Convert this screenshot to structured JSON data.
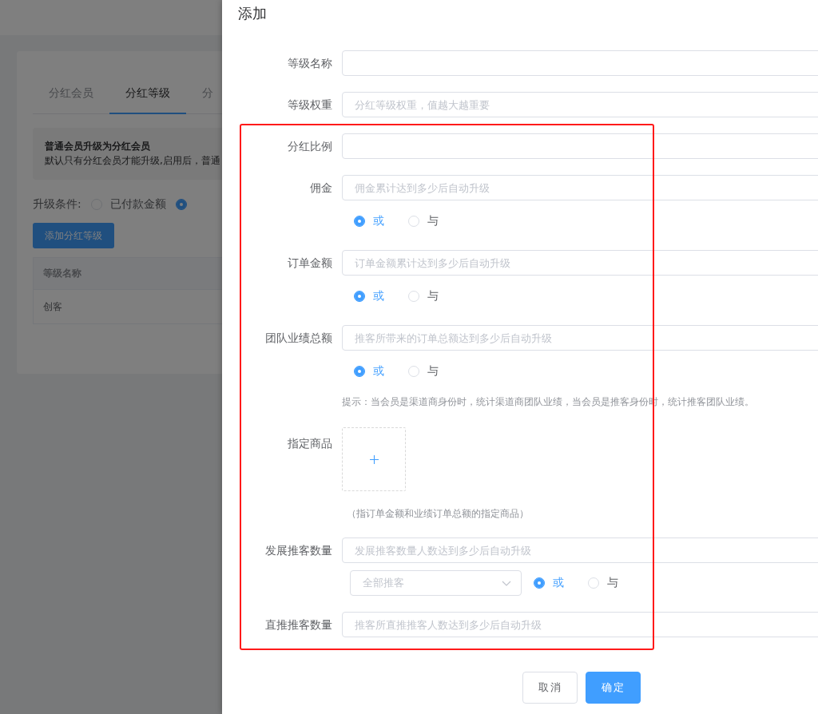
{
  "background": {
    "tabs": [
      {
        "label": "分红会员",
        "selected": false
      },
      {
        "label": "分红等级",
        "selected": true
      },
      {
        "label": "分",
        "selected": false
      }
    ],
    "notice": {
      "title": "普通会员升级为分红会员",
      "text": "默认只有分红会员才能升级,启用后，普通"
    },
    "upgrade_condition": {
      "label": "升级条件:",
      "options": [
        {
          "label": "已付款金额",
          "selected": false
        },
        {
          "selected": true
        }
      ]
    },
    "add_button": "添加分红等级",
    "table": {
      "columns": [
        "等级名称"
      ],
      "rows": [
        [
          "创客"
        ]
      ]
    }
  },
  "dialog": {
    "title": "添加",
    "rows": [
      {
        "kind": "input",
        "label": "等级名称"
      },
      {
        "kind": "input",
        "label": "等级权重",
        "placeholder": "分红等级权重，值越大越重要"
      },
      {
        "kind": "input",
        "label": "分红比例"
      },
      {
        "kind": "input",
        "label": "佣金",
        "placeholder": "佣金累计达到多少后自动升级"
      },
      {
        "kind": "logic",
        "options": [
          {
            "label": "或",
            "selected": true
          },
          {
            "label": "与",
            "selected": false
          }
        ]
      },
      {
        "kind": "input",
        "label": "订单金额",
        "placeholder": "订单金额累计达到多少后自动升级"
      },
      {
        "kind": "logic",
        "options": [
          {
            "label": "或",
            "selected": true
          },
          {
            "label": "与",
            "selected": false
          }
        ]
      },
      {
        "kind": "input",
        "label": "团队业绩总额",
        "placeholder": "推客所带来的订单总额达到多少后自动升级"
      },
      {
        "kind": "logic",
        "options": [
          {
            "label": "或",
            "selected": true
          },
          {
            "label": "与",
            "selected": false
          }
        ]
      },
      {
        "kind": "hint",
        "text": "提示：当会员是渠道商身份时，统计渠道商团队业绩，当会员是推客身份时，统计推客团队业绩。"
      },
      {
        "kind": "upload",
        "label": "指定商品"
      },
      {
        "kind": "note",
        "text": "（指订单金额和业绩订单总额的指定商品）"
      },
      {
        "kind": "input",
        "label": "发展推客数量",
        "placeholder": "发展推客数量人数达到多少后自动升级"
      },
      {
        "kind": "select_logic",
        "select_placeholder": "全部推客",
        "options": [
          {
            "label": "或",
            "selected": true
          },
          {
            "label": "与",
            "selected": false
          }
        ]
      },
      {
        "kind": "input",
        "label": "直推推客数量",
        "placeholder": "推客所直推推客人数达到多少后自动升级"
      }
    ],
    "buttons": [
      {
        "label": "取消",
        "kind": "default"
      },
      {
        "label": "确定",
        "kind": "primary"
      }
    ]
  }
}
